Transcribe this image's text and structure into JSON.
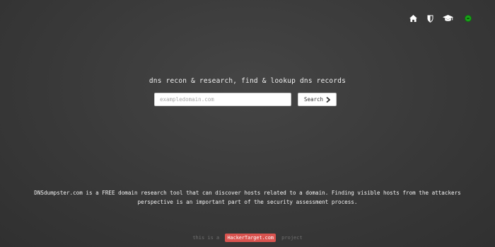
{
  "nav": {
    "icons": [
      "home-icon",
      "shield-icon",
      "graduation-cap-icon",
      "status-dot"
    ],
    "status_color": "#1aa31a"
  },
  "hero": {
    "tagline": "dns recon & research, find & lookup dns records",
    "search": {
      "placeholder": "exampledomain.com",
      "value": "",
      "button_label": "Search"
    }
  },
  "description": "DNSdumpster.com is a FREE domain research tool that can discover hosts related to a domain. Finding visible hosts from the attackers perspective is an important part of the security assessment process.",
  "footer": {
    "prefix": "this is a",
    "link_label": "HackerTarget.com",
    "suffix": "project",
    "badge_color": "#d9534f"
  }
}
